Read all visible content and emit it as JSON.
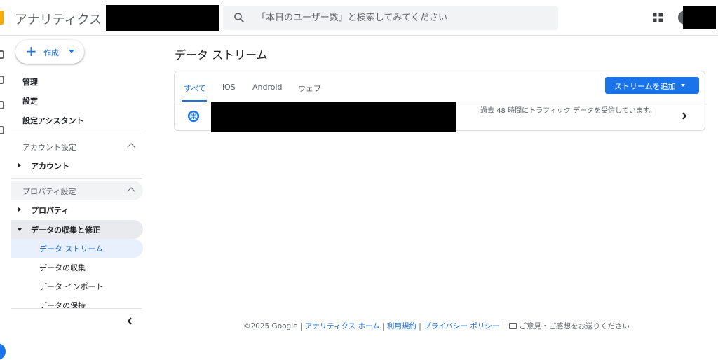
{
  "header": {
    "app_title": "アナリティクス",
    "search_placeholder": "「本日のユーザー数」と検索してみてください"
  },
  "nav": {
    "create_label": "作成",
    "items": [
      "管理",
      "設定",
      "設定アシスタント"
    ],
    "account_section": "アカウント設定",
    "account_item": "アカウント",
    "property_section": "プロパティ設定",
    "property_item": "プロパティ",
    "data_collection_item": "データの収集と修正",
    "sub_items": [
      "データ ストリーム",
      "データの収集",
      "データ インポート",
      "データの保持"
    ]
  },
  "main": {
    "title": "データ ストリーム",
    "tabs": [
      "すべて",
      "iOS",
      "Android",
      "ウェブ"
    ],
    "active_tab": "すべて",
    "add_stream_label": "ストリームを追加",
    "stream_status": "過去 48 時間にトラフィック データを受信しています。"
  },
  "footer": {
    "copyright": "©2025 Google",
    "links": [
      "アナリティクス ホーム",
      "利用規約",
      "プライバシー ポリシー"
    ],
    "feedback": "ご意見・ご感想をお送りください"
  },
  "colors": {
    "accent": "#1a73e8",
    "active_bg": "#e8f0fe",
    "logo": "#f9ab00"
  },
  "icons": [
    "search-icon",
    "apps-icon",
    "globe-icon",
    "chevron-right-icon",
    "chevron-left-icon",
    "feedback-icon"
  ]
}
